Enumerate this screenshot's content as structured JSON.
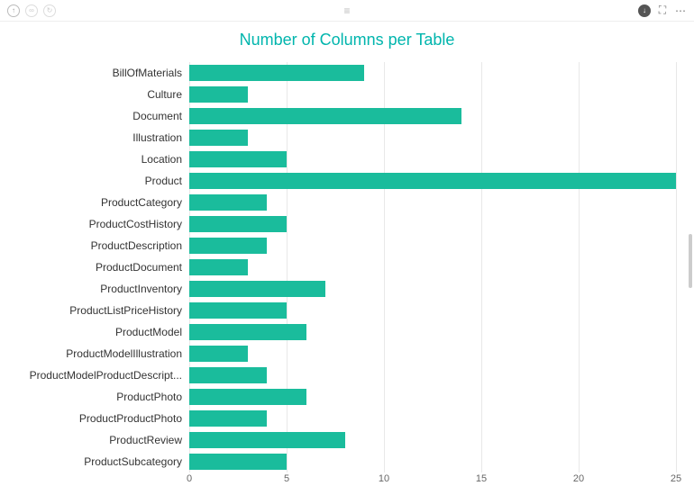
{
  "toolbar": {
    "left_icons": [
      "arrow-up",
      "link",
      "refresh"
    ],
    "center_icon": "drag-handle",
    "right_icons": [
      "arrow-down-fill",
      "focus-mode",
      "more-options"
    ]
  },
  "chart_data": {
    "type": "bar",
    "orientation": "horizontal",
    "title": "Number of Columns per Table",
    "xlabel": "",
    "ylabel": "",
    "xlim": [
      0,
      25
    ],
    "xticks": [
      0,
      5,
      10,
      15,
      20,
      25
    ],
    "categories": [
      "BillOfMaterials",
      "Culture",
      "Document",
      "Illustration",
      "Location",
      "Product",
      "ProductCategory",
      "ProductCostHistory",
      "ProductDescription",
      "ProductDocument",
      "ProductInventory",
      "ProductListPriceHistory",
      "ProductModel",
      "ProductModelIllustration",
      "ProductModelProductDescript...",
      "ProductPhoto",
      "ProductProductPhoto",
      "ProductReview",
      "ProductSubcategory"
    ],
    "values": [
      9,
      3,
      14,
      3,
      5,
      25,
      4,
      5,
      4,
      3,
      7,
      5,
      6,
      3,
      4,
      6,
      4,
      8,
      5
    ],
    "bar_color": "#1abc9c",
    "title_color": "#00b5ad"
  }
}
